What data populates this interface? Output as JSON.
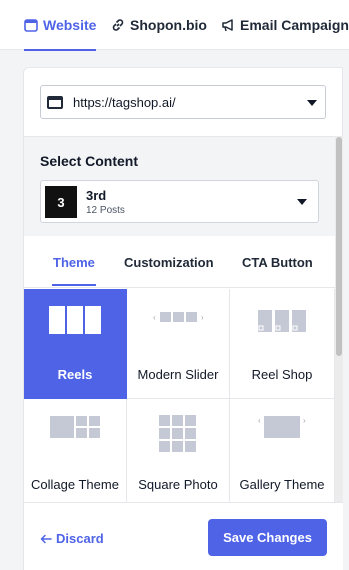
{
  "top_tabs": [
    {
      "label": "Website",
      "icon": "browser-window-icon",
      "active": true
    },
    {
      "label": "Shopon.bio",
      "icon": "link-icon",
      "active": false
    },
    {
      "label": "Email Campaign",
      "icon": "megaphone-icon",
      "active": false
    }
  ],
  "url_select": {
    "value": "https://tagshop.ai/",
    "icon": "browser-window-icon"
  },
  "select_content": {
    "title": "Select Content",
    "badge": "3",
    "name": "3rd",
    "posts": "12 Posts"
  },
  "theme_tabs": [
    {
      "label": "Theme",
      "active": true
    },
    {
      "label": "Customization",
      "active": false
    },
    {
      "label": "CTA Button",
      "active": false
    }
  ],
  "themes": [
    {
      "label": "Reels",
      "selected": true
    },
    {
      "label": "Modern Slider",
      "selected": false
    },
    {
      "label": "Reel Shop",
      "selected": false
    },
    {
      "label": "Collage Theme",
      "selected": false
    },
    {
      "label": "Square Photo",
      "selected": false
    },
    {
      "label": "Gallery Theme",
      "selected": false
    }
  ],
  "footer": {
    "discard_label": "Discard",
    "save_label": "Save Changes"
  },
  "colors": {
    "accent": "#4f63e7",
    "thumb_gray": "#c5c9d6"
  }
}
